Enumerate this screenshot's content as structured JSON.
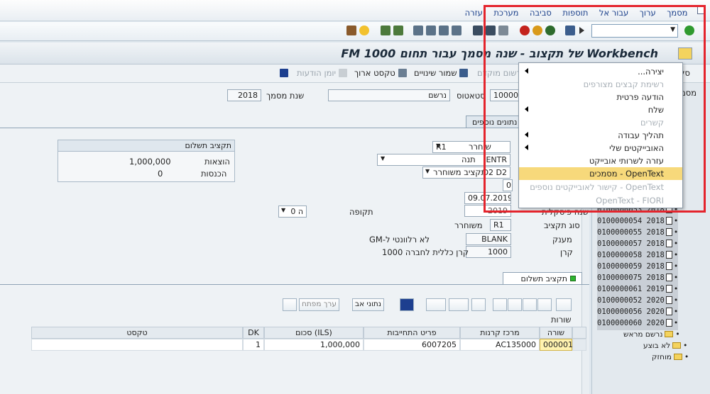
{
  "menubar": {
    "items": [
      "מסמך",
      "ערוך",
      "עבור אל",
      "תוספות",
      "סביבה",
      "מערכת",
      "עזרה"
    ]
  },
  "toolbar": {
    "command_value": ""
  },
  "title": "Workbench של תקצוב - שנה מסמך עבור תחום FM 1000",
  "appbar": {
    "items": [
      {
        "label": "סל",
        "disabled": false
      },
      {
        "label": "רשום מוקדם",
        "disabled": true
      },
      {
        "label": "שמור שינויים",
        "disabled": false
      },
      {
        "label": "טקסט ארוך",
        "disabled": false
      },
      {
        "label": "יומן הודעות",
        "disabled": true
      }
    ]
  },
  "header": {
    "doc_year_label": "שנת מסמך",
    "doc_year": "2018",
    "status_label": "סטאטוס",
    "status": "נרשם",
    "doc_number": "100000",
    "extra_tab": "נתונים נוספים"
  },
  "form": {
    "release_label": "שוחרר",
    "release": "R1",
    "entr": "ENTR",
    "entr_label": "תנה",
    "budget_label": "תקציב משוחרר",
    "budget": "D2 D2",
    "zero": "0",
    "date": "09.07.2019",
    "year_label": "שנה פיסקלית",
    "year": "2019",
    "period_label": "תקופה",
    "period": "0 ה",
    "budget_type_label": "סוג תקציב",
    "budget_type": "R1",
    "released_label": "משוחרר",
    "grant_label": "מענק",
    "grant": "BLANK",
    "grant_desc": "לא רלוונטי ל-GM",
    "fund_label": "קרן",
    "fund": "1000",
    "fund_desc": "קרן כללית לחברה 1000"
  },
  "payment_box": {
    "title": "תקציב תשלום",
    "expenses_label": "הוצאות",
    "expenses": "1,000,000",
    "income_label": "הכנסות",
    "income": "0"
  },
  "grid": {
    "tab": "תקציב תשלום",
    "buttons": {
      "entry_value": "ערך מפתח",
      "data": "נתוני אב"
    },
    "rows_label": "שורות",
    "columns": [
      "שורה",
      "מרכז קרנות",
      "פריט התחייבות",
      "סכום (ILS)",
      "DK",
      "טקסט"
    ],
    "rows": [
      [
        "000001",
        "AC135000",
        "6007205",
        "1,000,000",
        "1",
        ""
      ]
    ]
  },
  "tree": {
    "docs": [
      {
        "num": "0100000053",
        "year": "2018"
      },
      {
        "num": "0100000054",
        "year": "2018"
      },
      {
        "num": "0100000055",
        "year": "2018"
      },
      {
        "num": "0100000057",
        "year": "2018"
      },
      {
        "num": "0100000058",
        "year": "2018"
      },
      {
        "num": "0100000059",
        "year": "2018"
      },
      {
        "num": "0100000075",
        "year": "2018"
      },
      {
        "num": "0100000061",
        "year": "2019"
      },
      {
        "num": "0100000052",
        "year": "2020"
      },
      {
        "num": "0100000056",
        "year": "2020"
      },
      {
        "num": "0100000060",
        "year": "2020"
      }
    ],
    "folders": [
      "נרשם מראש",
      "לא בוצע",
      "מוחזק"
    ],
    "header": "מסמ"
  },
  "popup": {
    "items": [
      {
        "label": "יצירה...",
        "disabled": false,
        "submenu": true
      },
      {
        "label": "רשימת קבצים מצורפים",
        "disabled": true,
        "submenu": false
      },
      {
        "label": "הודעה פרטית",
        "disabled": false,
        "submenu": false
      },
      {
        "label": "שלח",
        "disabled": false,
        "submenu": true
      },
      {
        "label": "קשרים",
        "disabled": true,
        "submenu": false
      },
      {
        "label": "תהליך עבודה",
        "disabled": false,
        "submenu": true
      },
      {
        "label": "האובייקטים שלי",
        "disabled": false,
        "submenu": true
      },
      {
        "label": "עזרה לשרותי אובייקט",
        "disabled": false,
        "submenu": false
      },
      {
        "label": "OpenText - מסמכים",
        "disabled": false,
        "submenu": false,
        "highlight": true
      },
      {
        "label": "OpenText - קישור לאובייקטים נוספים",
        "disabled": true,
        "submenu": false
      },
      {
        "label": "OpenText - FIORI",
        "disabled": true,
        "submenu": false
      }
    ]
  }
}
